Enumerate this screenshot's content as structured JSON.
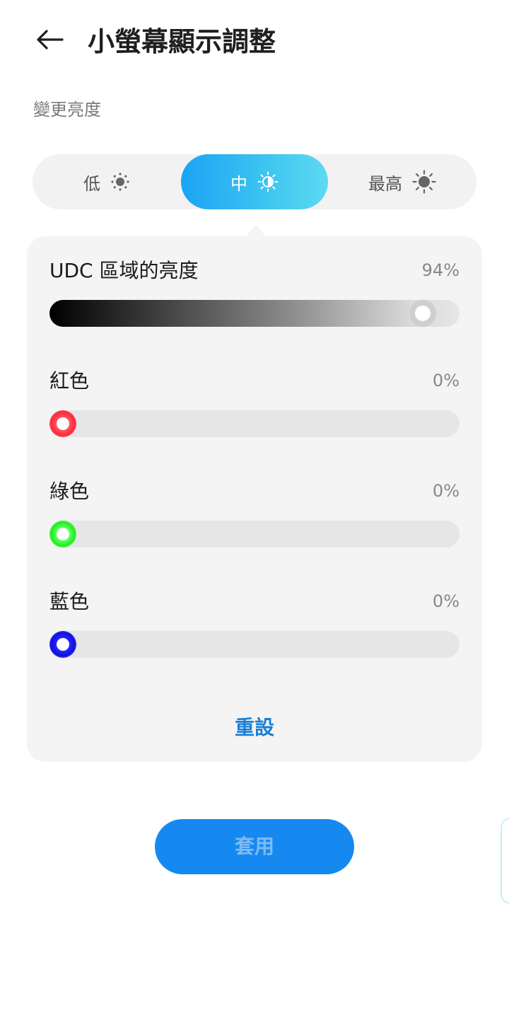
{
  "header": {
    "title": "小螢幕顯示調整",
    "back_icon": "arrow-left-icon"
  },
  "brightness": {
    "section_label": "變更亮度",
    "options": [
      {
        "label": "低",
        "icon": "sun-dim-icon",
        "selected": false
      },
      {
        "label": "中",
        "icon": "sun-half-icon",
        "selected": true
      },
      {
        "label": "最高",
        "icon": "sun-full-icon",
        "selected": false
      }
    ]
  },
  "panel": {
    "udc": {
      "label": "UDC 區域的亮度",
      "value": "94%",
      "level": 0.94
    },
    "red": {
      "label": "紅色",
      "value": "0%",
      "level": 0.0,
      "color": "#ff2a3d"
    },
    "green": {
      "label": "綠色",
      "value": "0%",
      "level": 0.0,
      "color": "#22ee22"
    },
    "blue": {
      "label": "藍色",
      "value": "0%",
      "level": 0.0,
      "color": "#1010dd"
    },
    "reset_label": "重設"
  },
  "apply_label": "套用",
  "colors": {
    "accent": "#1689f0",
    "selected_gradient_start": "#1ba3f5",
    "selected_gradient_end": "#5dd9f2",
    "link": "#1b7fd6"
  }
}
